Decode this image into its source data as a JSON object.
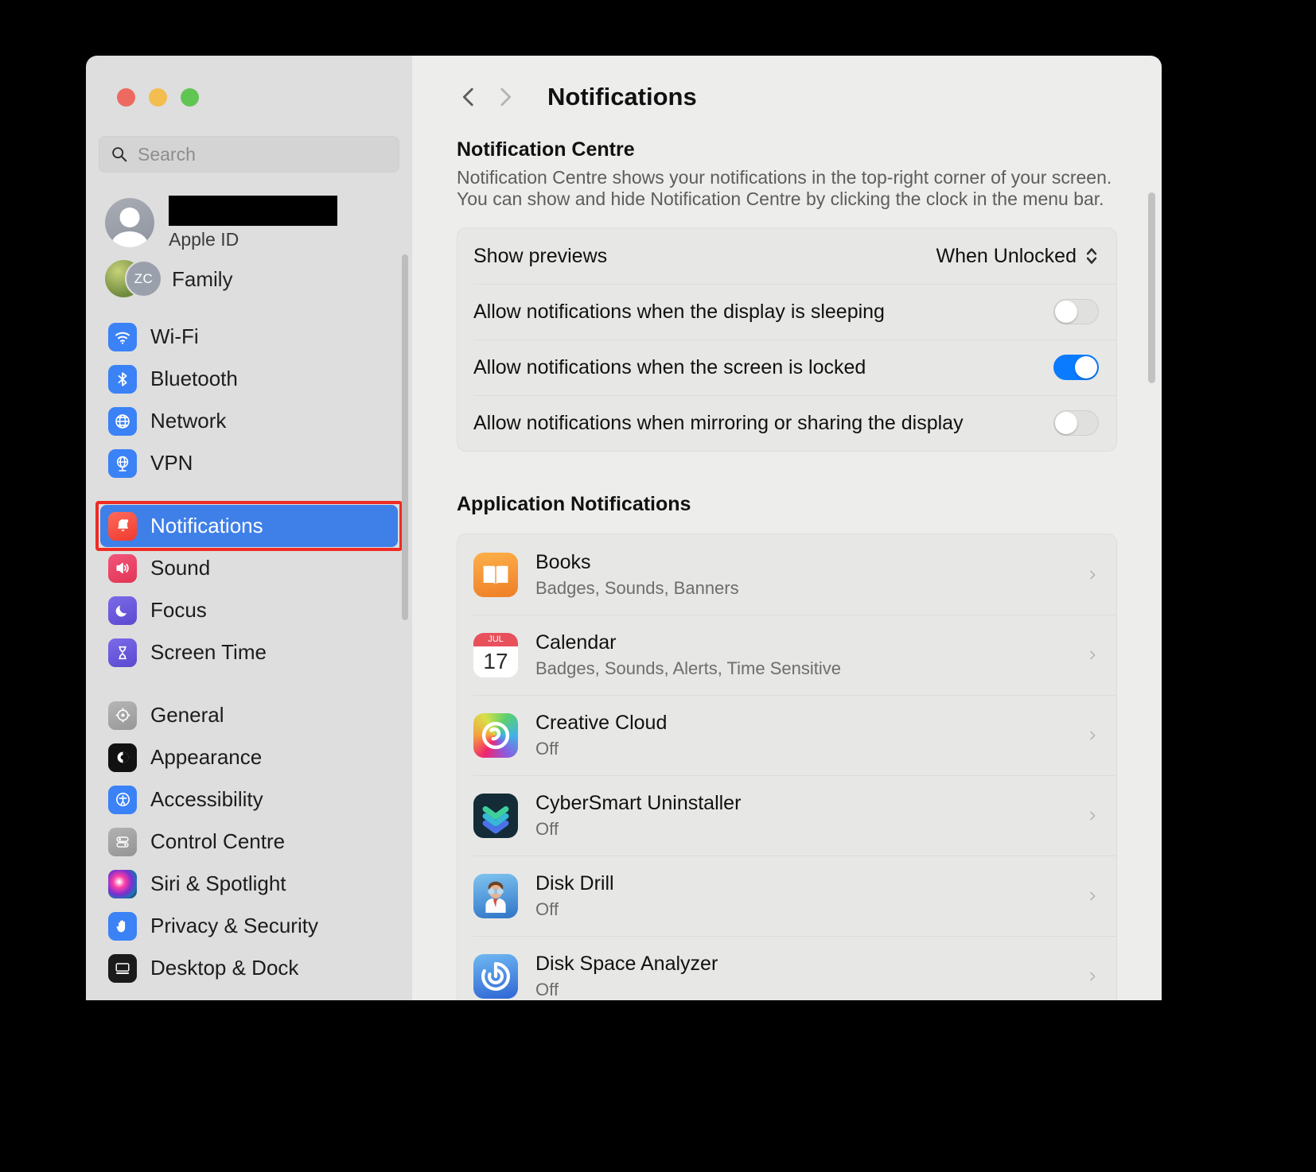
{
  "window": {
    "traffic_lights": [
      "close",
      "minimize",
      "zoom"
    ]
  },
  "sidebar": {
    "search": {
      "placeholder": "Search",
      "value": "",
      "icon": "search-icon"
    },
    "account": {
      "name_redacted": "",
      "subtitle": "Apple ID",
      "avatar_icon": "person-avatar"
    },
    "family": {
      "label": "Family",
      "badge_initials": "ZC"
    },
    "groups": [
      {
        "items": [
          {
            "label": "Wi-Fi",
            "icon": "wifi-icon",
            "selected": false
          },
          {
            "label": "Bluetooth",
            "icon": "bluetooth-icon",
            "selected": false
          },
          {
            "label": "Network",
            "icon": "network-globe-icon",
            "selected": false
          },
          {
            "label": "VPN",
            "icon": "vpn-globe-icon",
            "selected": false
          }
        ]
      },
      {
        "items": [
          {
            "label": "Notifications",
            "icon": "bell-icon",
            "selected": true,
            "highlighted": true
          },
          {
            "label": "Sound",
            "icon": "speaker-icon",
            "selected": false
          },
          {
            "label": "Focus",
            "icon": "moon-icon",
            "selected": false
          },
          {
            "label": "Screen Time",
            "icon": "hourglass-icon",
            "selected": false
          }
        ]
      },
      {
        "items": [
          {
            "label": "General",
            "icon": "gear-icon",
            "selected": false
          },
          {
            "label": "Appearance",
            "icon": "appearance-contrast-icon",
            "selected": false
          },
          {
            "label": "Accessibility",
            "icon": "accessibility-icon",
            "selected": false
          },
          {
            "label": "Control Centre",
            "icon": "control-centre-icon",
            "selected": false
          },
          {
            "label": "Siri & Spotlight",
            "icon": "siri-icon",
            "selected": false
          },
          {
            "label": "Privacy & Security",
            "icon": "hand-icon",
            "selected": false
          },
          {
            "label": "Desktop & Dock",
            "icon": "desktop-dock-icon",
            "selected": false
          }
        ]
      }
    ]
  },
  "header": {
    "back_label": "Back",
    "forward_label": "Forward",
    "title": "Notifications"
  },
  "notification_centre": {
    "title": "Notification Centre",
    "description": "Notification Centre shows your notifications in the top-right corner of your screen. You can show and hide Notification Centre by clicking the clock in the menu bar.",
    "rows": [
      {
        "label": "Show previews",
        "type": "select",
        "value": "When Unlocked"
      },
      {
        "label": "Allow notifications when the display is sleeping",
        "type": "toggle",
        "value": "off"
      },
      {
        "label": "Allow notifications when the screen is locked",
        "type": "toggle",
        "value": "on"
      },
      {
        "label": "Allow notifications when mirroring or sharing the display",
        "type": "toggle",
        "value": "off"
      }
    ]
  },
  "application_notifications": {
    "title": "Application Notifications",
    "apps": [
      {
        "name": "Books",
        "status": "Badges, Sounds, Banners",
        "icon": "books-app-icon"
      },
      {
        "name": "Calendar",
        "status": "Badges, Sounds, Alerts, Time Sensitive",
        "icon": "calendar-app-icon",
        "calendar_month": "JUL",
        "calendar_day": "17"
      },
      {
        "name": "Creative Cloud",
        "status": "Off",
        "icon": "creative-cloud-app-icon"
      },
      {
        "name": "CyberSmart Uninstaller",
        "status": "Off",
        "icon": "cybersmart-app-icon"
      },
      {
        "name": "Disk Drill",
        "status": "Off",
        "icon": "disk-drill-app-icon"
      },
      {
        "name": "Disk Space Analyzer",
        "status": "Off",
        "icon": "disk-space-analyzer-app-icon"
      }
    ]
  },
  "colors": {
    "accent_blue": "#0a7bff",
    "selection_blue": "#3f7fe8",
    "highlight_red": "#ef2b24",
    "sidebar_bg": "#dedede",
    "detail_bg": "#ededec"
  }
}
